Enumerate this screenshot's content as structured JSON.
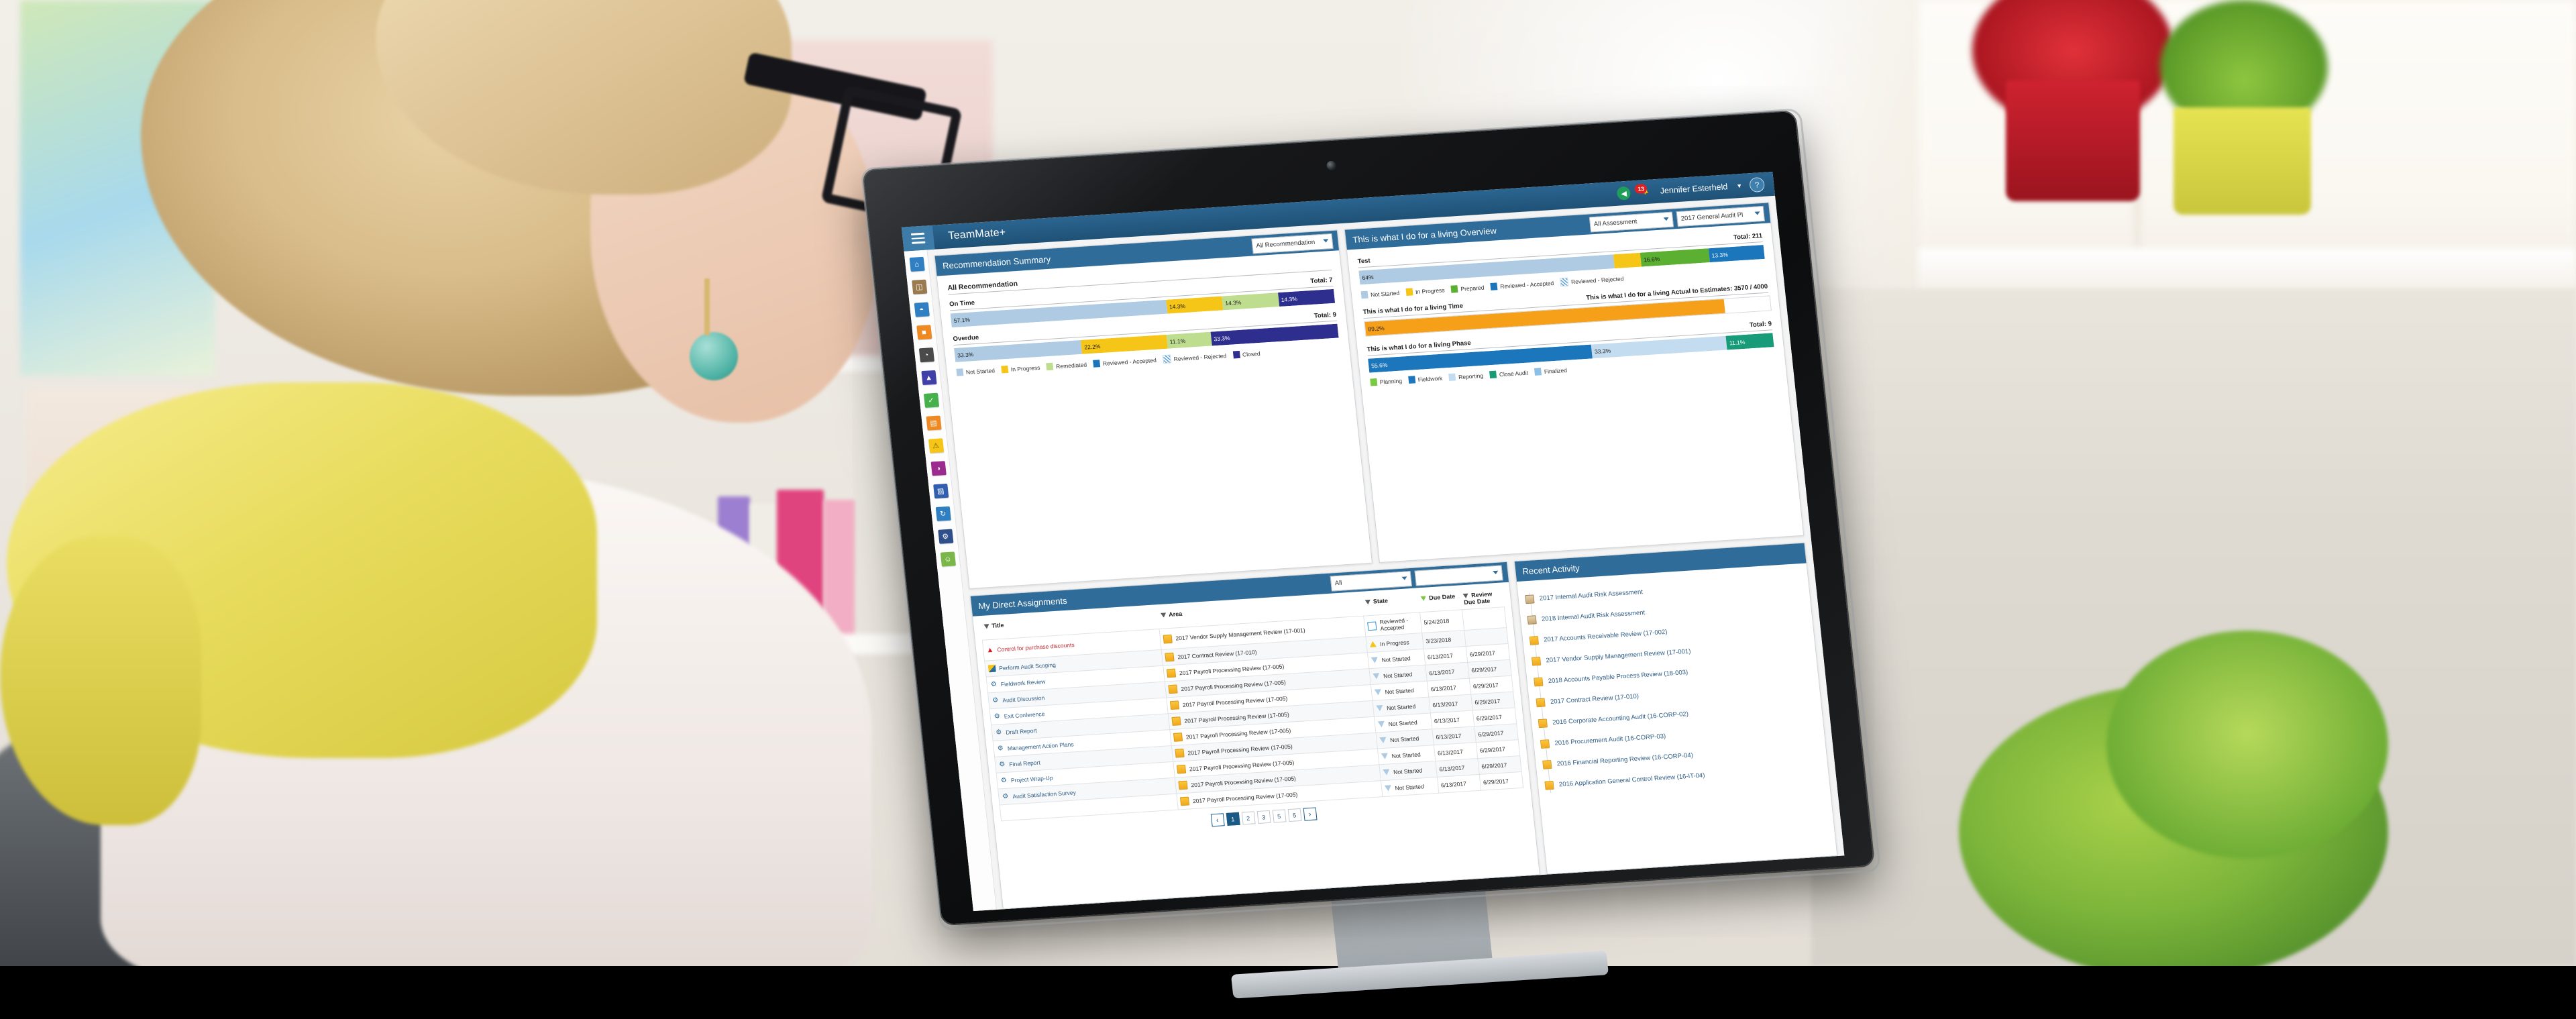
{
  "app": {
    "title": "TeamMate+",
    "menu_icon": "hamburger-icon",
    "user_name": "Jennifer Esterheld",
    "notification_count": "13",
    "help_icon": "?",
    "back_icon": "◀"
  },
  "rail": {
    "items": [
      {
        "name": "home",
        "glyph": "⌂",
        "bg": "#2f7fc2"
      },
      {
        "name": "clipboard",
        "glyph": "Ὄb",
        "bg": "#9a7a4e"
      },
      {
        "name": "planning",
        "glyph": "◥",
        "bg": "#2f7fc2"
      },
      {
        "name": "projects",
        "glyph": "■",
        "bg": "#ef8a22"
      },
      {
        "name": "time",
        "glyph": "◔",
        "bg": "#4a4a4a"
      },
      {
        "name": "alerts",
        "glyph": "▲",
        "bg": "#3f3fa8"
      },
      {
        "name": "approvals",
        "glyph": "✓",
        "bg": "#46b14b"
      },
      {
        "name": "documents",
        "glyph": "▤",
        "bg": "#ef8a22"
      },
      {
        "name": "issues",
        "glyph": "⚠",
        "bg": "#f5c518"
      },
      {
        "name": "analytics",
        "glyph": "◑",
        "bg": "#9b2b8e"
      },
      {
        "name": "library",
        "glyph": "▧",
        "bg": "#2f5fae"
      },
      {
        "name": "refresh",
        "glyph": "↻",
        "bg": "#2f7fc2"
      },
      {
        "name": "settings",
        "glyph": "⚙",
        "bg": "#2f4f8a"
      },
      {
        "name": "people",
        "glyph": "☺",
        "bg": "#7ab648"
      }
    ]
  },
  "recommendation_panel": {
    "title": "Recommendation Summary",
    "filter_value": "All Recommendation",
    "section_label": "All Recommendation",
    "legend": [
      {
        "label": "Not Started",
        "color": "#aecbe3"
      },
      {
        "label": "In Progress",
        "color": "#f5c518"
      },
      {
        "label": "Remediated",
        "color": "#bedd8f"
      },
      {
        "label": "Reviewed - Accepted",
        "color": "#1b76bc"
      },
      {
        "label": "Reviewed - Rejected",
        "color": "hatch"
      },
      {
        "label": "Closed",
        "color": "#2e2e8f"
      }
    ]
  },
  "overview_panel": {
    "title": "This is what I do for a living Overview",
    "filter_assessment": "All Assessment",
    "filter_plan": "2017 General Audit Pl",
    "test_label": "Test",
    "test_total": "Total: 211",
    "time_label": "This is what I do for a living Time",
    "time_actual_label": "This is what I do for a living Actual to Estimates: 3570 / 4000",
    "phase_label": "This is what I do for a living Phase",
    "phase_total": "Total: 9",
    "test_legend": [
      {
        "label": "Not Started",
        "color": "#aecbe3"
      },
      {
        "label": "In Progress",
        "color": "#f5c518"
      },
      {
        "label": "Prepared",
        "color": "#5cb031"
      },
      {
        "label": "Reviewed - Accepted",
        "color": "#1b76bc"
      },
      {
        "label": "Reviewed - Rejected",
        "color": "hatch"
      }
    ],
    "phase_legend": [
      {
        "label": "Planning",
        "color": "#7ac943"
      },
      {
        "label": "Fieldwork",
        "color": "#1b76bc"
      },
      {
        "label": "Reporting",
        "color": "#c3dcef"
      },
      {
        "label": "Close Audit",
        "color": "#179b79"
      },
      {
        "label": "Finalized",
        "color": "#8cc0e6"
      }
    ]
  },
  "chart_data": [
    {
      "type": "bar",
      "title": "Recommendation Summary - On Time",
      "orientation": "stacked-horizontal",
      "row_label": "On Time",
      "total_label": "Total: 7",
      "total": 7,
      "categories": [
        "Not Started",
        "In Progress",
        "Remediated",
        "Closed"
      ],
      "values": [
        57.1,
        14.3,
        14.3,
        14.3
      ],
      "value_labels": [
        "57.1%",
        "14.3%",
        "14.3%",
        "14.3%"
      ],
      "colors": [
        "#aecbe3",
        "#f5c518",
        "#bedd8f",
        "#2e2e8f"
      ],
      "xlabel": "",
      "ylabel": "",
      "ylim": [
        0,
        100
      ]
    },
    {
      "type": "bar",
      "title": "Recommendation Summary - Overdue",
      "orientation": "stacked-horizontal",
      "row_label": "Overdue",
      "total_label": "Total: 9",
      "total": 9,
      "categories": [
        "Not Started",
        "In Progress",
        "Remediated",
        "Closed"
      ],
      "values": [
        33.3,
        22.2,
        11.1,
        33.3
      ],
      "value_labels": [
        "33.3%",
        "22.2%",
        "11.1%",
        "33.3%"
      ],
      "colors": [
        "#aecbe3",
        "#f5c518",
        "#bedd8f",
        "#2e2e8f"
      ],
      "xlabel": "",
      "ylabel": "",
      "ylim": [
        0,
        100
      ]
    },
    {
      "type": "bar",
      "title": "Test",
      "orientation": "stacked-horizontal",
      "row_label": "Test",
      "total_label": "Total: 211",
      "total": 211,
      "categories": [
        "Not Started",
        "In Progress",
        "Prepared",
        "Reviewed - Accepted"
      ],
      "values": [
        64,
        6.1,
        16.6,
        13.3
      ],
      "value_labels": [
        "64%",
        "",
        "16.6%",
        "13.3%"
      ],
      "colors": [
        "#aecbe3",
        "#f5c518",
        "#5cb031",
        "#1b76bc"
      ],
      "xlabel": "",
      "ylabel": "",
      "ylim": [
        0,
        100
      ]
    },
    {
      "type": "bar",
      "title": "This is what I do for a living Time",
      "orientation": "progress-horizontal",
      "row_label": "This is what I do for a living Time",
      "total_label": "This is what I do for a living Actual to Estimates: 3570 / 4000",
      "categories": [
        "Actual"
      ],
      "values": [
        89.2
      ],
      "value_labels": [
        "89.2%"
      ],
      "colors": [
        "#f6a01a"
      ],
      "xlabel": "",
      "ylabel": "",
      "ylim": [
        0,
        100
      ]
    },
    {
      "type": "bar",
      "title": "This is what I do for a living Phase",
      "orientation": "stacked-horizontal",
      "row_label": "This is what I do for a living Phase",
      "total_label": "Total: 9",
      "total": 9,
      "categories": [
        "Fieldwork",
        "Reporting",
        "Close Audit"
      ],
      "values": [
        55.6,
        33.3,
        11.1
      ],
      "value_labels": [
        "55.6%",
        "33.3%",
        "11.1%"
      ],
      "colors": [
        "#1b76bc",
        "#c3dcef",
        "#179b79"
      ],
      "xlabel": "",
      "ylabel": "",
      "ylim": [
        0,
        100
      ]
    }
  ],
  "assignments_panel": {
    "title": "My Direct Assignments",
    "filter_value": "All",
    "search_value": "",
    "columns": [
      "Title",
      "Area",
      "State",
      "Due Date",
      "Review Due Date"
    ],
    "rows": [
      {
        "icon": "warning-icon",
        "title": "Control for purchase discounts",
        "area": "2017 Vendor Supply Management Review (17-001)",
        "area_icon": "folder-icon",
        "state": "Reviewed - Accepted",
        "state_icon": "flag-icon",
        "due": "5/24/2018",
        "review_due": ""
      },
      {
        "icon": "scoping-icon",
        "title": "Perform Audit Scoping",
        "area": "2017 Contract Review (17-010)",
        "area_icon": "folder-icon",
        "state": "In Progress",
        "state_icon": "triangle-up-icon",
        "due": "3/23/2018",
        "review_due": ""
      },
      {
        "icon": "gear-icon",
        "title": "Fieldwork Review",
        "area": "2017 Payroll Processing Review (17-005)",
        "area_icon": "folder-icon",
        "state": "Not Started",
        "state_icon": "triangle-down-icon",
        "due": "6/13/2017",
        "review_due": "6/29/2017"
      },
      {
        "icon": "gear-icon",
        "title": "Audit Discussion",
        "area": "2017 Payroll Processing Review (17-005)",
        "area_icon": "folder-icon",
        "state": "Not Started",
        "state_icon": "triangle-down-icon",
        "due": "6/13/2017",
        "review_due": "6/29/2017"
      },
      {
        "icon": "gear-icon",
        "title": "Exit Conference",
        "area": "2017 Payroll Processing Review (17-005)",
        "area_icon": "folder-icon",
        "state": "Not Started",
        "state_icon": "triangle-down-icon",
        "due": "6/13/2017",
        "review_due": "6/29/2017"
      },
      {
        "icon": "gear-icon",
        "title": "Draft Report",
        "area": "2017 Payroll Processing Review (17-005)",
        "area_icon": "folder-icon",
        "state": "Not Started",
        "state_icon": "triangle-down-icon",
        "due": "6/13/2017",
        "review_due": "6/29/2017"
      },
      {
        "icon": "gear-icon",
        "title": "Management Action Plans",
        "area": "2017 Payroll Processing Review (17-005)",
        "area_icon": "folder-icon",
        "state": "Not Started",
        "state_icon": "triangle-down-icon",
        "due": "6/13/2017",
        "review_due": "6/29/2017"
      },
      {
        "icon": "gear-icon",
        "title": "Final Report",
        "area": "2017 Payroll Processing Review (17-005)",
        "area_icon": "folder-icon",
        "state": "Not Started",
        "state_icon": "triangle-down-icon",
        "due": "6/13/2017",
        "review_due": "6/29/2017"
      },
      {
        "icon": "gear-icon",
        "title": "Project Wrap-Up",
        "area": "2017 Payroll Processing Review (17-005)",
        "area_icon": "folder-icon",
        "state": "Not Started",
        "state_icon": "triangle-down-icon",
        "due": "6/13/2017",
        "review_due": "6/29/2017"
      },
      {
        "icon": "gear-icon",
        "title": "Audit Satisfaction Survey",
        "area": "2017 Payroll Processing Review (17-005)",
        "area_icon": "folder-icon",
        "state": "Not Started",
        "state_icon": "triangle-down-icon",
        "due": "6/13/2017",
        "review_due": "6/29/2017"
      },
      {
        "icon": "",
        "title": "",
        "area": "2017 Payroll Processing Review (17-005)",
        "area_icon": "folder-icon",
        "state": "Not Started",
        "state_icon": "triangle-down-icon",
        "due": "6/13/2017",
        "review_due": "6/29/2017"
      }
    ],
    "pagination": {
      "prev": "‹",
      "next": "›",
      "pages": [
        "1",
        "2",
        "3",
        "5",
        "5"
      ],
      "active": "1"
    }
  },
  "recent_activity": {
    "title": "Recent Activity",
    "items": [
      {
        "icon": "clipboard-icon",
        "label": "2017 Internal Audit Risk Assessment"
      },
      {
        "icon": "clipboard-icon",
        "label": "2018 Internal Audit Risk Assessment"
      },
      {
        "icon": "folder-icon",
        "label": "2017 Accounts Receivable Review (17-002)"
      },
      {
        "icon": "folder-icon",
        "label": "2017 Vendor Supply Management Review (17-001)"
      },
      {
        "icon": "folder-icon",
        "label": "2018 Accounts Payable Process Review (18-003)"
      },
      {
        "icon": "folder-icon",
        "label": "2017 Contract Review (17-010)"
      },
      {
        "icon": "folder-icon",
        "label": "2016 Corporate Accounting Audit (16-CORP-02)"
      },
      {
        "icon": "folder-icon",
        "label": "2016 Procurement Audit (16-CORP-03)"
      },
      {
        "icon": "folder-icon",
        "label": "2016 Financial Reporting Review (16-CORP-04)"
      },
      {
        "icon": "folder-icon",
        "label": "2016 Application General Control Review (16-IT-04)"
      }
    ]
  },
  "theme": {
    "header_blue": "#2f6c99",
    "appbar_blue": "#1f5176",
    "accent_orange": "#f6a01a",
    "link_blue": "#2f5d86"
  }
}
